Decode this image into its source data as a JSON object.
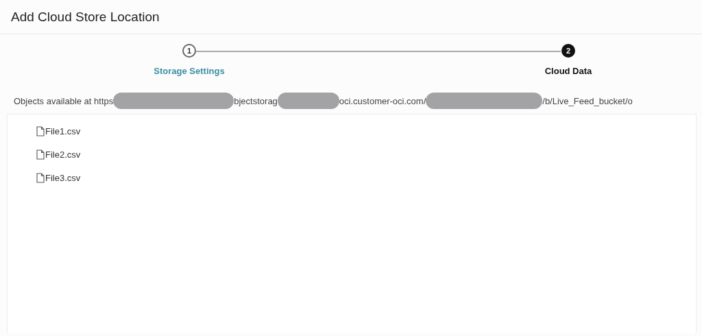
{
  "window": {
    "title": "Add Cloud Store Location"
  },
  "steps": [
    {
      "number": "1",
      "label": "Storage Settings",
      "selected": false
    },
    {
      "number": "2",
      "label": "Cloud Data",
      "selected": true
    }
  ],
  "location": {
    "parts": [
      {
        "kind": "text",
        "text": "Objects available at https"
      },
      {
        "kind": "redacted"
      },
      {
        "kind": "text",
        "text": "bjectstorag"
      },
      {
        "kind": "redacted"
      },
      {
        "kind": "text",
        "text": "oci.customer-oci.com/"
      },
      {
        "kind": "redacted"
      },
      {
        "kind": "text",
        "text": "/b/Live_Feed_bucket/o"
      }
    ]
  },
  "files": [
    {
      "name": "File1.csv"
    },
    {
      "name": "File2.csv"
    },
    {
      "name": "File3.csv"
    }
  ]
}
